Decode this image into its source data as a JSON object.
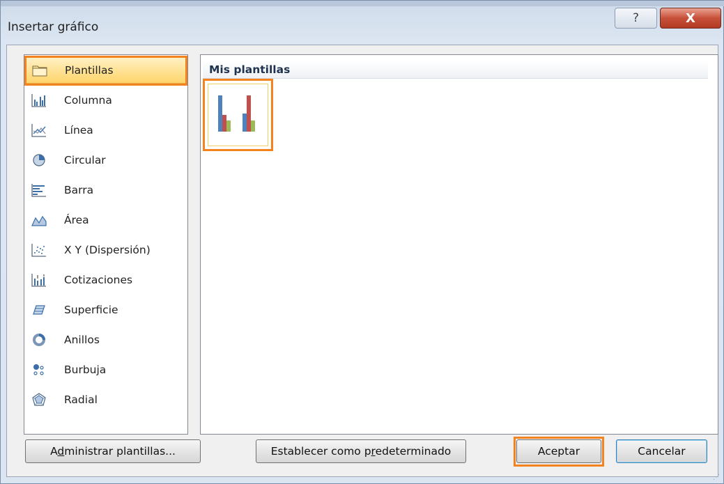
{
  "dialog": {
    "title": "Insertar gráfico",
    "help_label": "?",
    "close_label": "X"
  },
  "sidebar": {
    "items": [
      {
        "label": "Plantillas",
        "icon": "folder-icon",
        "selected": true
      },
      {
        "label": "Columna",
        "icon": "column-chart-icon"
      },
      {
        "label": "Línea",
        "icon": "line-chart-icon"
      },
      {
        "label": "Circular",
        "icon": "pie-chart-icon"
      },
      {
        "label": "Barra",
        "icon": "bar-chart-icon"
      },
      {
        "label": "Área",
        "icon": "area-chart-icon"
      },
      {
        "label": "X Y (Dispersión)",
        "icon": "scatter-chart-icon"
      },
      {
        "label": "Cotizaciones",
        "icon": "stock-chart-icon"
      },
      {
        "label": "Superficie",
        "icon": "surface-chart-icon"
      },
      {
        "label": "Anillos",
        "icon": "doughnut-chart-icon"
      },
      {
        "label": "Burbuja",
        "icon": "bubble-chart-icon"
      },
      {
        "label": "Radial",
        "icon": "radar-chart-icon"
      }
    ]
  },
  "main": {
    "section_title": "Mis plantillas",
    "templates": [
      {
        "icon": "clustered-column-template-icon",
        "selected": true
      }
    ]
  },
  "buttons": {
    "manage_pre": "A",
    "manage_ul": "d",
    "manage_post": "ministrar plantillas...",
    "default_pre": "Establecer como p",
    "default_ul": "r",
    "default_post": "edeterminado",
    "ok": "Aceptar",
    "cancel": "Cancelar"
  },
  "colors": {
    "highlight": "#f3821f",
    "selection": "#ffd46a",
    "series": [
      "#4f81bd",
      "#c0504d",
      "#9bbb59"
    ]
  }
}
